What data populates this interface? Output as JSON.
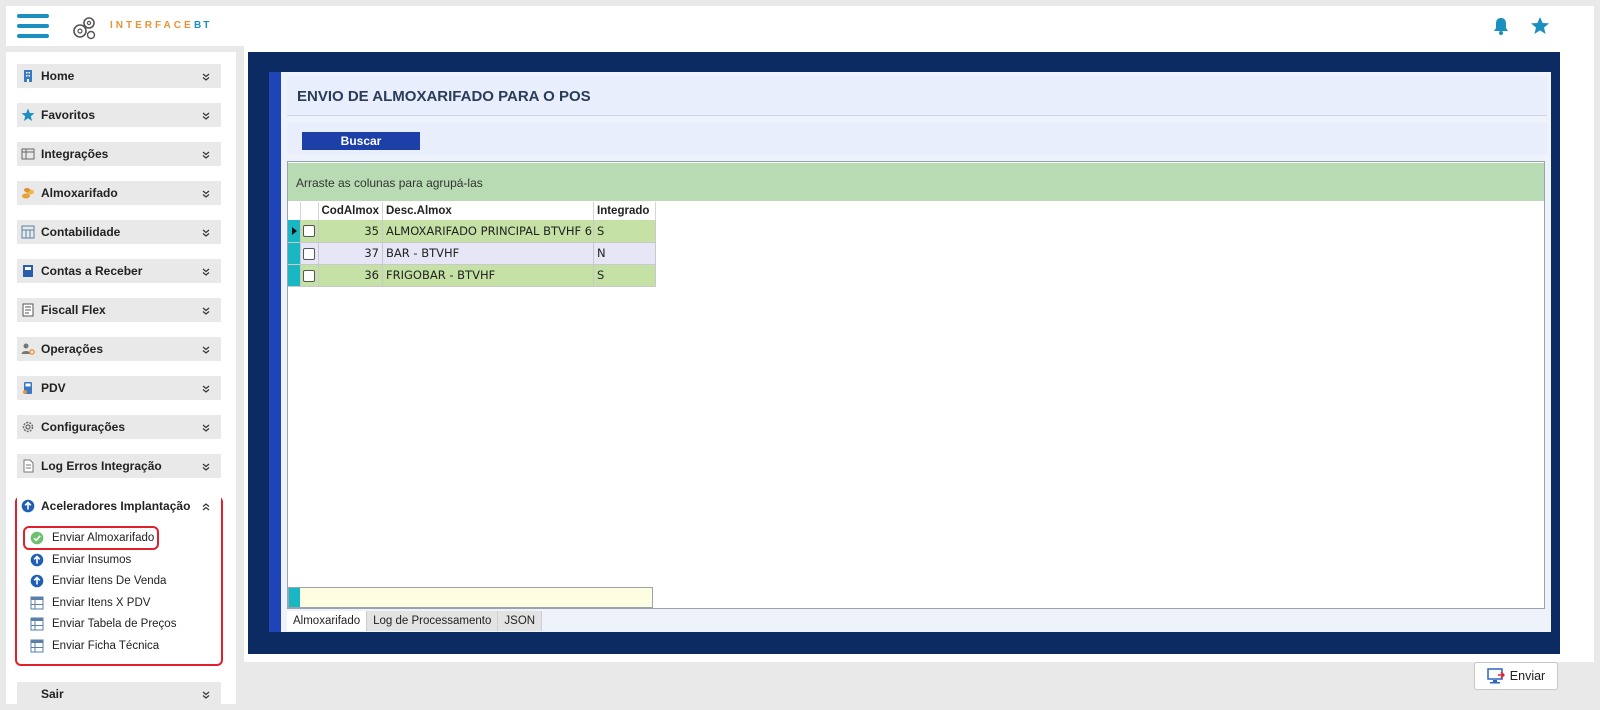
{
  "app": {
    "logo_text": "INTERFACE",
    "logo_suffix": "BT"
  },
  "sidebar": {
    "items": [
      {
        "label": "Home",
        "icon": "building-icon"
      },
      {
        "label": "Favoritos",
        "icon": "star-icon"
      },
      {
        "label": "Integrações",
        "icon": "table-icon"
      },
      {
        "label": "Almoxarifado",
        "icon": "coins-icon"
      },
      {
        "label": "Contabilidade",
        "icon": "calc-grid-icon"
      },
      {
        "label": "Contas a Receber",
        "icon": "ledger-icon"
      },
      {
        "label": "Fiscall Flex",
        "icon": "document-calc-icon"
      },
      {
        "label": "Operações",
        "icon": "user-gear-icon"
      },
      {
        "label": "PDV",
        "icon": "pos-terminal-icon"
      },
      {
        "label": "Configurações",
        "icon": "gear-icon"
      },
      {
        "label": "Log Erros Integração",
        "icon": "log-document-icon"
      },
      {
        "label": "Aceleradores Implantação",
        "icon": "arrow-up-circle-icon"
      }
    ],
    "sub_items": [
      {
        "label": "Enviar Almoxarifado",
        "icon": "check-circle-icon"
      },
      {
        "label": "Enviar Insumos",
        "icon": "arrow-up-circle-icon"
      },
      {
        "label": "Enviar Itens De Venda",
        "icon": "arrow-up-circle-icon"
      },
      {
        "label": "Enviar Itens X PDV",
        "icon": "grid-icon"
      },
      {
        "label": "Enviar Tabela de Preços",
        "icon": "grid-icon"
      },
      {
        "label": "Enviar Ficha Técnica",
        "icon": "grid-icon"
      }
    ],
    "partial_next_label": "Sair"
  },
  "page": {
    "title": "ENVIO DE ALMOXARIFADO PARA O POS",
    "search_button": "Buscar",
    "group_hint": "Arraste as colunas para agrupá-las"
  },
  "grid": {
    "columns": [
      "CodAlmox",
      "Desc.Almox",
      "Integrado"
    ],
    "rows": [
      {
        "cod": "35",
        "desc": "ALMOXARIFADO PRINCIPAL BTVHF 6",
        "integrado": "S",
        "checked": false,
        "current": true
      },
      {
        "cod": "37",
        "desc": "BAR - BTVHF",
        "integrado": "N",
        "checked": false,
        "current": false
      },
      {
        "cod": "36",
        "desc": "FRIGOBAR - BTVHF",
        "integrado": "S",
        "checked": false,
        "current": false
      }
    ]
  },
  "tabs": [
    "Almoxarifado",
    "Log de Processamento",
    "JSON"
  ],
  "footer": {
    "send_button": "Enviar"
  },
  "colors": {
    "navy_frame": "#0d2b63",
    "accent_blue": "#1a8fc0",
    "logo_orange": "#e59536",
    "row_green": "#c5e1a5",
    "row_lavender": "#e6e6f6",
    "highlight_red": "#e0202a"
  }
}
